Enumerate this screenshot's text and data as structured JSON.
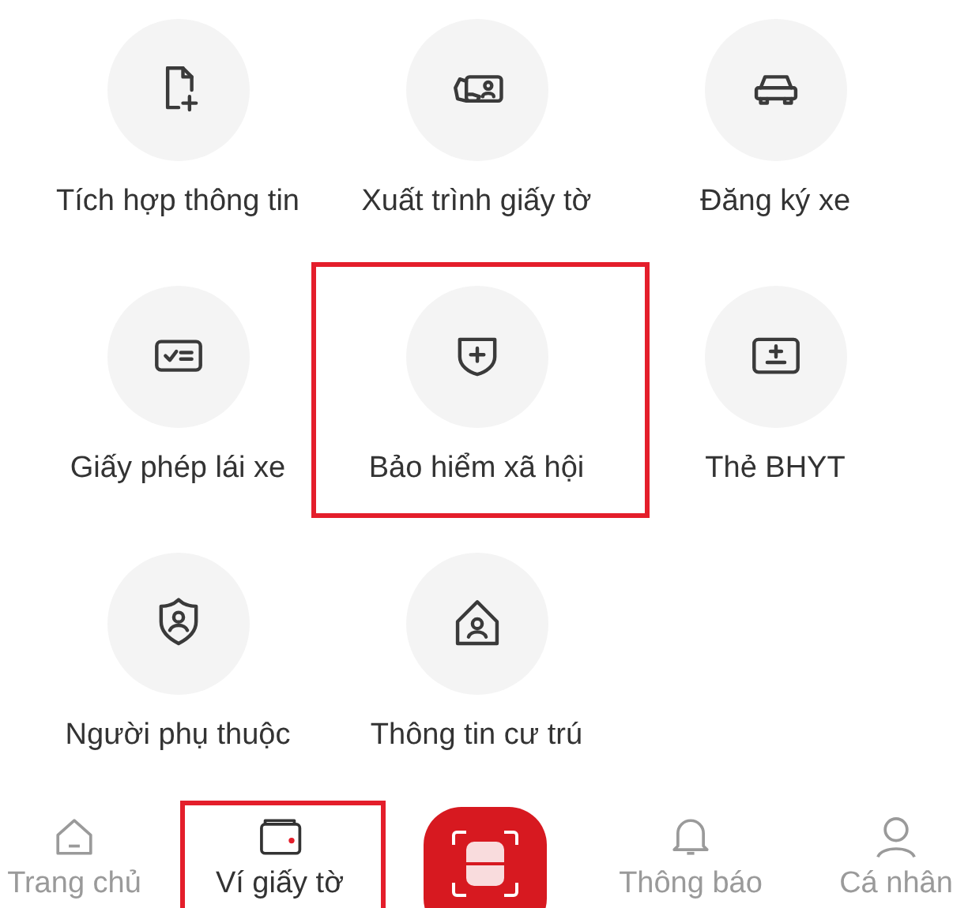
{
  "items": [
    {
      "label": "Tích hợp thông tin",
      "highlighted": false
    },
    {
      "label": "Xuất trình giấy tờ",
      "highlighted": false
    },
    {
      "label": "Đăng ký xe",
      "highlighted": false
    },
    {
      "label": "Giấy phép lái xe",
      "highlighted": false
    },
    {
      "label": "Bảo hiểm xã hội",
      "highlighted": true
    },
    {
      "label": "Thẻ BHYT",
      "highlighted": false
    },
    {
      "label": "Người phụ thuộc",
      "highlighted": false
    },
    {
      "label": "Thông tin cư trú",
      "highlighted": false
    }
  ],
  "tab_bar": [
    {
      "kind": "tab",
      "label": "Trang chủ",
      "selected": false,
      "highlighted": false
    },
    {
      "kind": "tab",
      "label": "Ví giấy tờ",
      "selected": true,
      "highlighted": true
    },
    {
      "kind": "scan"
    },
    {
      "kind": "tab",
      "label": "Thông báo",
      "selected": false,
      "highlighted": false
    },
    {
      "kind": "tab",
      "label": "Cá nhân",
      "selected": false,
      "highlighted": false
    }
  ]
}
